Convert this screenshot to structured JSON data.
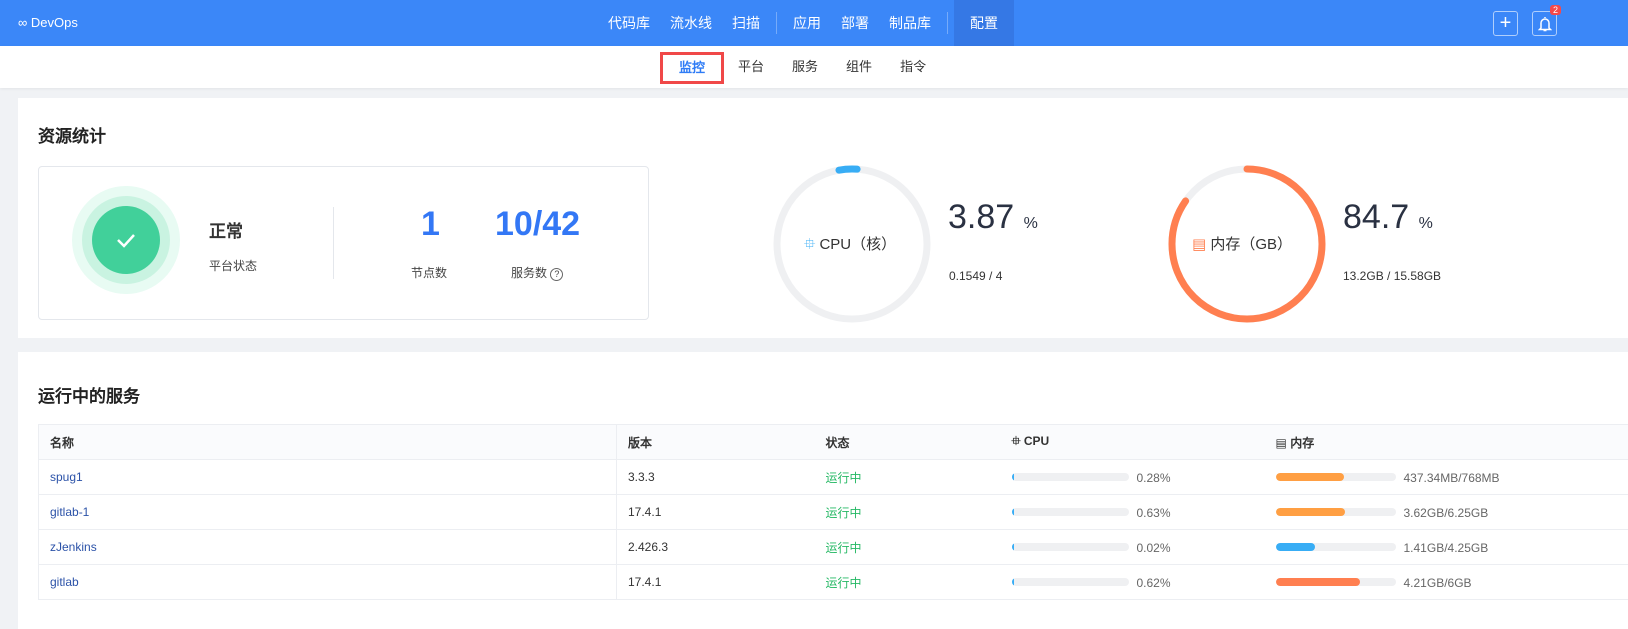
{
  "header": {
    "logo": "∞ DevOps",
    "nav": [
      "代码库",
      "流水线",
      "扫描",
      "应用",
      "部署",
      "制品库",
      "配置"
    ],
    "active": "配置",
    "add_label": "+",
    "notif_count": "2"
  },
  "subnav": {
    "items": [
      "监控",
      "平台",
      "服务",
      "组件",
      "指令"
    ],
    "active": "监控"
  },
  "resources": {
    "title": "资源统计",
    "status": "正常",
    "status_label": "平台状态",
    "nodes": "1",
    "nodes_label": "节点数",
    "services": "10/42",
    "services_label": "服务数",
    "help": "?",
    "cpu": {
      "label": "CPU（核）",
      "percent": "3.87",
      "unit": "%",
      "detail": "0.1549 / 4",
      "fraction": 0.0387,
      "color": "#38adf5"
    },
    "mem": {
      "label": "内存（GB）",
      "percent": "84.7",
      "unit": "%",
      "detail": "13.2GB / 15.58GB",
      "fraction": 0.847,
      "color": "#ff7f50"
    }
  },
  "services": {
    "title": "运行中的服务",
    "columns": [
      "名称",
      "版本",
      "状态",
      "CPU",
      "内存"
    ],
    "rows": [
      {
        "name": "spug1",
        "version": "3.3.3",
        "status": "运行中",
        "cpu": "0.28%",
        "cpu_frac": 0.0028,
        "mem": "437.34MB/768MB",
        "mem_frac": 0.57,
        "mem_color": "#ff9f43"
      },
      {
        "name": "gitlab-1",
        "version": "17.4.1",
        "status": "运行中",
        "cpu": "0.63%",
        "cpu_frac": 0.0063,
        "mem": "3.62GB/6.25GB",
        "mem_frac": 0.58,
        "mem_color": "#ff9f43"
      },
      {
        "name": "zJenkins",
        "version": "2.426.3",
        "status": "运行中",
        "cpu": "0.02%",
        "cpu_frac": 0.0002,
        "mem": "1.41GB/4.25GB",
        "mem_frac": 0.33,
        "mem_color": "#38adf5"
      },
      {
        "name": "gitlab",
        "version": "17.4.1",
        "status": "运行中",
        "cpu": "0.62%",
        "cpu_frac": 0.0062,
        "mem": "4.21GB/6GB",
        "mem_frac": 0.7,
        "mem_color": "#ff7f50"
      }
    ]
  }
}
